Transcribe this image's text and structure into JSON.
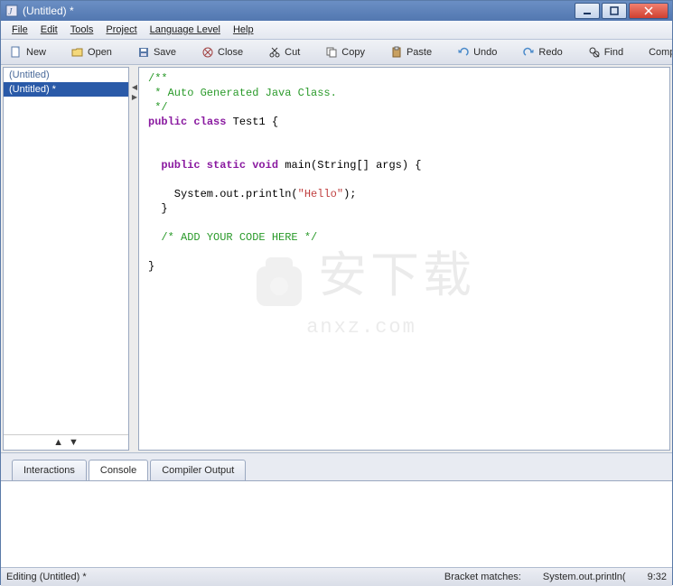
{
  "window": {
    "title": "(Untitled) *"
  },
  "menu": {
    "file": "File",
    "edit": "Edit",
    "tools": "Tools",
    "project": "Project",
    "language_level": "Language Level",
    "help": "Help"
  },
  "toolbar": {
    "new": "New",
    "open": "Open",
    "save": "Save",
    "close": "Close",
    "cut": "Cut",
    "copy": "Copy",
    "paste": "Paste",
    "undo": "Undo",
    "redo": "Redo",
    "find": "Find",
    "compile": "Comp"
  },
  "sidebar": {
    "files": [
      {
        "label": "(Untitled)",
        "active": false
      },
      {
        "label": "(Untitled) *",
        "active": true
      }
    ]
  },
  "editor": {
    "lines": {
      "l1": "/**",
      "l2": " * Auto Generated Java Class.",
      "l3": " */",
      "l4a": "public",
      "l4b": " class",
      "l4c": " Test1 {",
      "l5": "",
      "l6": "",
      "l7a": "  public",
      "l7b": " static",
      "l7c": " void",
      "l7d": " main(String[] args) {",
      "l8": "",
      "l9a": "    System.out.println(",
      "l9b": "\"Hello\"",
      "l9c": ");",
      "l10": "  }",
      "l11": "",
      "l12a": "  /* ",
      "l12b": "ADD YOUR CODE HERE",
      "l12c": " */",
      "l13": "",
      "l14": "}"
    }
  },
  "bottom_tabs": {
    "interactions": "Interactions",
    "console": "Console",
    "compiler_output": "Compiler Output"
  },
  "status": {
    "left": "Editing (Untitled) *",
    "bracket": "Bracket matches:",
    "match": "System.out.println(",
    "position": "9:32"
  },
  "watermark": {
    "main": "安下载",
    "sub": "anxz.com"
  }
}
